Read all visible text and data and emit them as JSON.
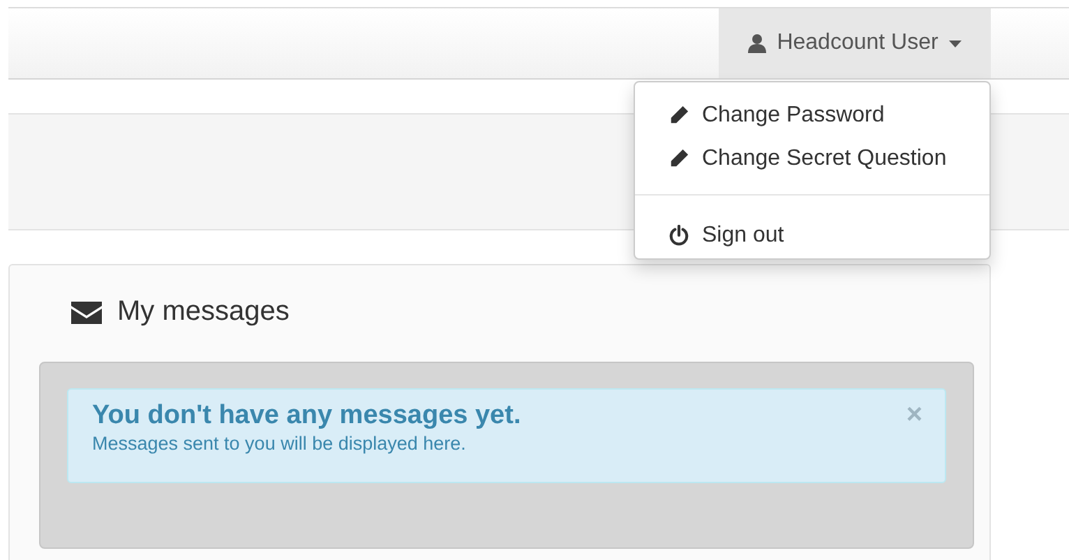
{
  "navbar": {
    "user_menu": {
      "label": "Headcount User",
      "expanded": true,
      "items": [
        {
          "kind": "pencil",
          "label": "Change Password"
        },
        {
          "kind": "pencil",
          "label": "Change Secret Question"
        },
        {
          "kind": "divider"
        },
        {
          "kind": "power",
          "label": "Sign out"
        }
      ]
    }
  },
  "messages_panel": {
    "title": "My messages",
    "alert": {
      "heading": "You don't have any messages yet.",
      "text": "Messages sent to you will be displayed here.",
      "close": "×"
    }
  }
}
